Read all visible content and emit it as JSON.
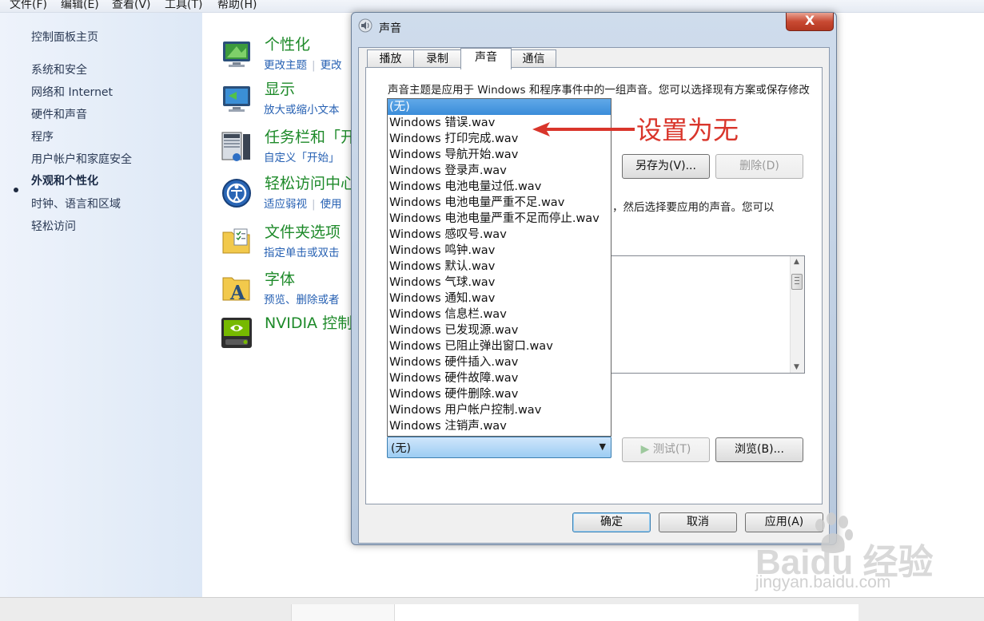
{
  "menu": [
    "文件(F)",
    "编辑(E)",
    "查看(V)",
    "工具(T)",
    "帮助(H)"
  ],
  "left_nav": {
    "home": "控制面板主页",
    "items": [
      "系统和安全",
      "网络和 Internet",
      "硬件和声音",
      "程序",
      "用户帐户和家庭安全",
      "外观和个性化",
      "时钟、语言和区域",
      "轻松访问"
    ],
    "active_index": 5
  },
  "categories": [
    {
      "title": "个性化",
      "links": [
        "更改主题",
        "更改"
      ]
    },
    {
      "title": "显示",
      "links": [
        "放大或缩小文本"
      ]
    },
    {
      "title": "任务栏和「开",
      "links": [
        "自定义「开始」"
      ]
    },
    {
      "title": "轻松访问中心",
      "links": [
        "适应弱视",
        "使用"
      ]
    },
    {
      "title": "文件夹选项",
      "links": [
        "指定单击或双击"
      ]
    },
    {
      "title": "字体",
      "links": [
        "预览、删除或者"
      ]
    },
    {
      "title": "NVIDIA 控制",
      "links": []
    }
  ],
  "dialog": {
    "title": "声音",
    "close_label": "X",
    "tabs": [
      "播放",
      "录制",
      "声音",
      "通信"
    ],
    "active_tab": 2,
    "description": "声音主题是应用于 Windows 和程序事件中的一组声音。您可以选择现有方案或保存修改后的方案。",
    "description2": "，然后选择要应用的声音。您可以",
    "save_as_label": "另存为(V)...",
    "delete_label": "删除(D)",
    "test_label": "测试(T)",
    "browse_label": "浏览(B)...",
    "ok_label": "确定",
    "cancel_label": "取消",
    "apply_label": "应用(A)",
    "combo_value": "(无)",
    "sound_options": [
      "(无)",
      "Windows 错误.wav",
      "Windows 打印完成.wav",
      "Windows 导航开始.wav",
      "Windows 登录声.wav",
      "Windows 电池电量过低.wav",
      "Windows 电池电量严重不足.wav",
      "Windows 电池电量严重不足而停止.wav",
      "Windows 感叹号.wav",
      "Windows 鸣钟.wav",
      "Windows 默认.wav",
      "Windows 气球.wav",
      "Windows 通知.wav",
      "Windows 信息栏.wav",
      "Windows 已发现源.wav",
      "Windows 已阻止弹出窗口.wav",
      "Windows 硬件插入.wav",
      "Windows 硬件故障.wav",
      "Windows 硬件删除.wav",
      "Windows 用户帐户控制.wav",
      "Windows 注销声.wav"
    ],
    "selected_option_index": 0
  },
  "annotation": {
    "text": "设置为无",
    "color": "#d9352b"
  },
  "watermark": {
    "main": "Baidu 经验",
    "sub": "jingyan.baidu.com"
  },
  "colors": {
    "category_title": "#1e8a2a",
    "link": "#2761b3",
    "selection": "#3a8cd9"
  }
}
